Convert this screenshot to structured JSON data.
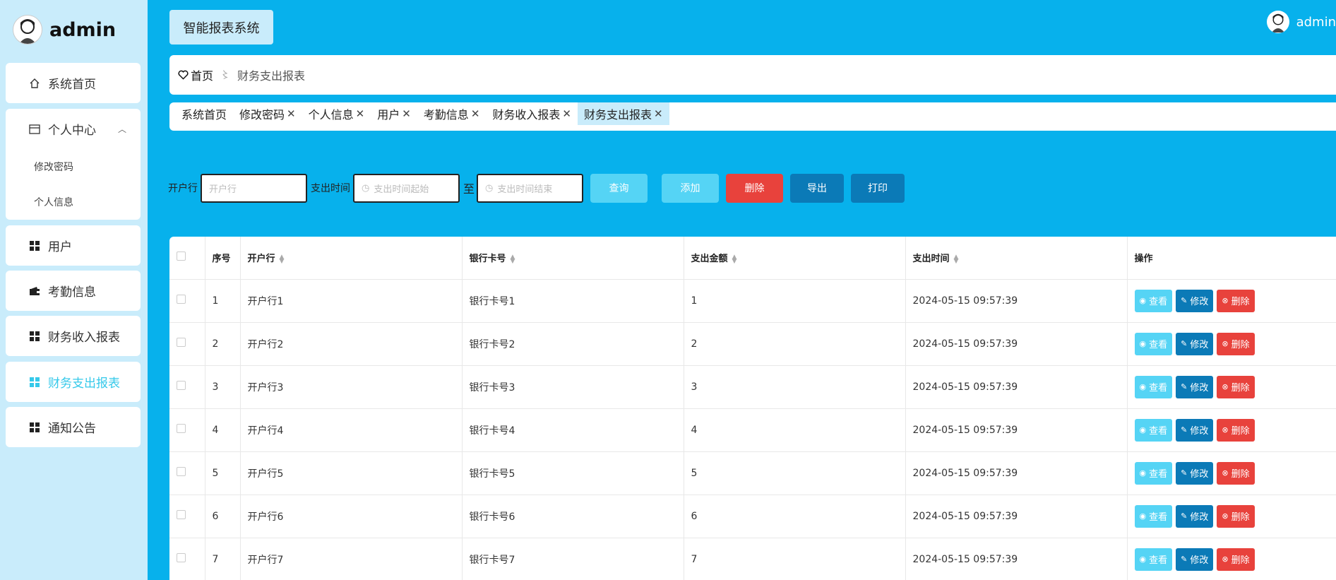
{
  "brand": {
    "title": "admin"
  },
  "sidebar": {
    "items": [
      {
        "label": "系统首页",
        "icon": "home-icon"
      },
      {
        "label": "个人中心",
        "icon": "card-icon",
        "children": [
          {
            "label": "修改密码"
          },
          {
            "label": "个人信息"
          }
        ]
      },
      {
        "label": "用户",
        "icon": "grid-icon"
      },
      {
        "label": "考勤信息",
        "icon": "wallet-icon"
      },
      {
        "label": "财务收入报表",
        "icon": "grid-icon"
      },
      {
        "label": "财务支出报表",
        "icon": "grid-icon",
        "active": true
      },
      {
        "label": "通知公告",
        "icon": "grid-icon"
      }
    ]
  },
  "header": {
    "system_title": "智能报表系统",
    "user_name": "admin"
  },
  "breadcrumb": {
    "home": "首页",
    "separator": "〻",
    "current": "财务支出报表"
  },
  "tabs": [
    {
      "label": "系统首页",
      "closable": false
    },
    {
      "label": "修改密码",
      "closable": true
    },
    {
      "label": "个人信息",
      "closable": true
    },
    {
      "label": "用户",
      "closable": true
    },
    {
      "label": "考勤信息",
      "closable": true
    },
    {
      "label": "财务收入报表",
      "closable": true
    },
    {
      "label": "财务支出报表",
      "closable": true,
      "active": true
    }
  ],
  "tab_close_glyph": "✕",
  "search": {
    "bank_label": "开户行",
    "bank_placeholder": "开户行",
    "time_label": "支出时间",
    "start_placeholder": "支出时间起始",
    "to_label": "至",
    "end_placeholder": "支出时间结束",
    "query": "查询",
    "add": "添加",
    "delete": "删除",
    "export": "导出",
    "print": "打印"
  },
  "table": {
    "headers": {
      "index": "序号",
      "bank": "开户行",
      "card": "银行卡号",
      "amount": "支出金额",
      "time": "支出时间",
      "ops": "操作"
    },
    "rows": [
      {
        "index": "1",
        "bank": "开户行1",
        "card": "银行卡号1",
        "amount": "1",
        "time": "2024-05-15 09:57:39"
      },
      {
        "index": "2",
        "bank": "开户行2",
        "card": "银行卡号2",
        "amount": "2",
        "time": "2024-05-15 09:57:39"
      },
      {
        "index": "3",
        "bank": "开户行3",
        "card": "银行卡号3",
        "amount": "3",
        "time": "2024-05-15 09:57:39"
      },
      {
        "index": "4",
        "bank": "开户行4",
        "card": "银行卡号4",
        "amount": "4",
        "time": "2024-05-15 09:57:39"
      },
      {
        "index": "5",
        "bank": "开户行5",
        "card": "银行卡号5",
        "amount": "5",
        "time": "2024-05-15 09:57:39"
      },
      {
        "index": "6",
        "bank": "开户行6",
        "card": "银行卡号6",
        "amount": "6",
        "time": "2024-05-15 09:57:39"
      },
      {
        "index": "7",
        "bank": "开户行7",
        "card": "银行卡号7",
        "amount": "7",
        "time": "2024-05-15 09:57:39"
      }
    ],
    "row_actions": {
      "view": "查看",
      "edit": "修改",
      "delete": "删除"
    }
  },
  "colors": {
    "primary": "#07b1ec",
    "sidebar_bg": "#c9ecfb",
    "light_btn": "#55d4f5",
    "danger": "#e8423c",
    "dark_btn": "#0b7ab7",
    "active_menu": "#35c9ea"
  }
}
